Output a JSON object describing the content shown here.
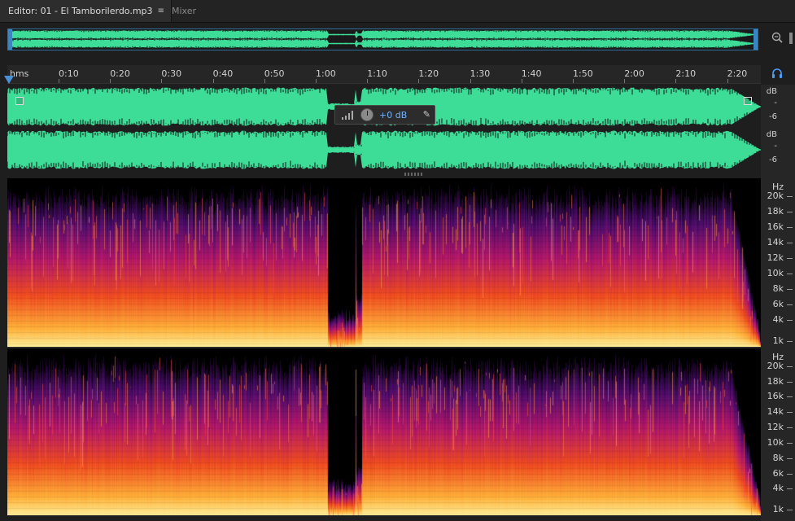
{
  "tabs": {
    "editor_label": "Editor: 01 - El Tamborilerdo.mp3",
    "editor_menu": "≡",
    "mixer_label": "Mixer"
  },
  "ruler": {
    "unit_label": "hms",
    "ticks": [
      "0:10",
      "0:20",
      "0:30",
      "0:40",
      "0:50",
      "1:00",
      "1:10",
      "1:20",
      "1:30",
      "1:40",
      "1:50",
      "2:00",
      "2:10",
      "2:20"
    ],
    "duration_seconds": 155
  },
  "hud": {
    "volume_label": "+0 dB"
  },
  "waveform": {
    "color": "#3ddc97",
    "db_scale": {
      "channel_1": [
        "dB",
        "-",
        "-6"
      ],
      "channel_2": [
        "dB",
        "-",
        "-6"
      ]
    }
  },
  "spectral": {
    "hz_scale_top": [
      "Hz",
      "20k",
      "18k",
      "16k",
      "14k",
      "12k",
      "10k",
      "8k",
      "6k",
      "4k",
      "1k"
    ],
    "hz_scale_bottom": [
      "Hz",
      "20k",
      "18k",
      "16k",
      "14k",
      "12k",
      "10k",
      "8k",
      "6k",
      "4k",
      "1k"
    ]
  },
  "icons": {
    "zoom": "magnifier-icon",
    "headphones": "headphones-icon"
  }
}
